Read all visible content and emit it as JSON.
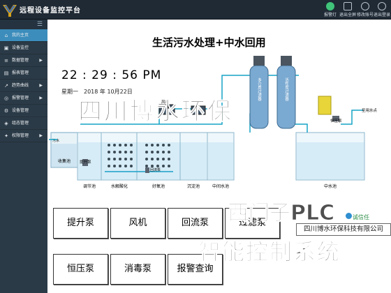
{
  "app": {
    "title": "远程设备监控平台"
  },
  "top_actions": [
    {
      "label": "报警灯",
      "color": "#3fc47a"
    },
    {
      "label": "退出全屏",
      "color": "#b9c3cc"
    },
    {
      "label": "修改账号",
      "color": "#b9c3cc"
    },
    {
      "label": "退出登录",
      "color": "#b9c3cc"
    }
  ],
  "sidebar": {
    "items": [
      {
        "label": "我的主页",
        "icon": "home-icon",
        "has_arrow": false
      },
      {
        "label": "设备监控",
        "icon": "monitor-icon",
        "has_arrow": false
      },
      {
        "label": "数据管理",
        "icon": "database-icon",
        "has_arrow": true
      },
      {
        "label": "报表管理",
        "icon": "report-icon",
        "has_arrow": false
      },
      {
        "label": "趋势曲线",
        "icon": "chart-icon",
        "has_arrow": true
      },
      {
        "label": "报警管理",
        "icon": "alarm-icon",
        "has_arrow": true
      },
      {
        "label": "设备管理",
        "icon": "device-icon",
        "has_arrow": false
      },
      {
        "label": "组态管理",
        "icon": "config-icon",
        "has_arrow": false
      },
      {
        "label": "权限管理",
        "icon": "permission-icon",
        "has_arrow": true
      }
    ]
  },
  "main": {
    "title": "生活污水处理+中水回用",
    "clock": "22 : 29 : 56  PM",
    "date": "星期一　2018 年 10月22日"
  },
  "diagram": {
    "tank_labels": [
      "调节池",
      "水解酸化",
      "好氧池",
      "沉淀池",
      "中间水池",
      "中水池"
    ],
    "equipment_labels": {
      "inlet": "污水",
      "collection": "收集池",
      "lift_pump": "提升泵",
      "fan": "风机",
      "return_pump": "回流泵",
      "constant_pump": "恒压泵",
      "reuse": "至用水点",
      "filter1": "多介质过滤器",
      "filter2": "活性炭过滤器"
    }
  },
  "buttons": [
    {
      "label": "提升泵"
    },
    {
      "label": "风机"
    },
    {
      "label": "回流泵"
    },
    {
      "label": "过滤泵"
    },
    {
      "label": "恒压泵"
    },
    {
      "label": "消毒泵"
    },
    {
      "label": "报警查询"
    }
  ],
  "watermarks": {
    "company": "四川博水环保",
    "plc": "西门子PLC",
    "system": "智能控制系统",
    "brand": "四川博水环保科技有限公司",
    "brand_small": "诚信任"
  }
}
